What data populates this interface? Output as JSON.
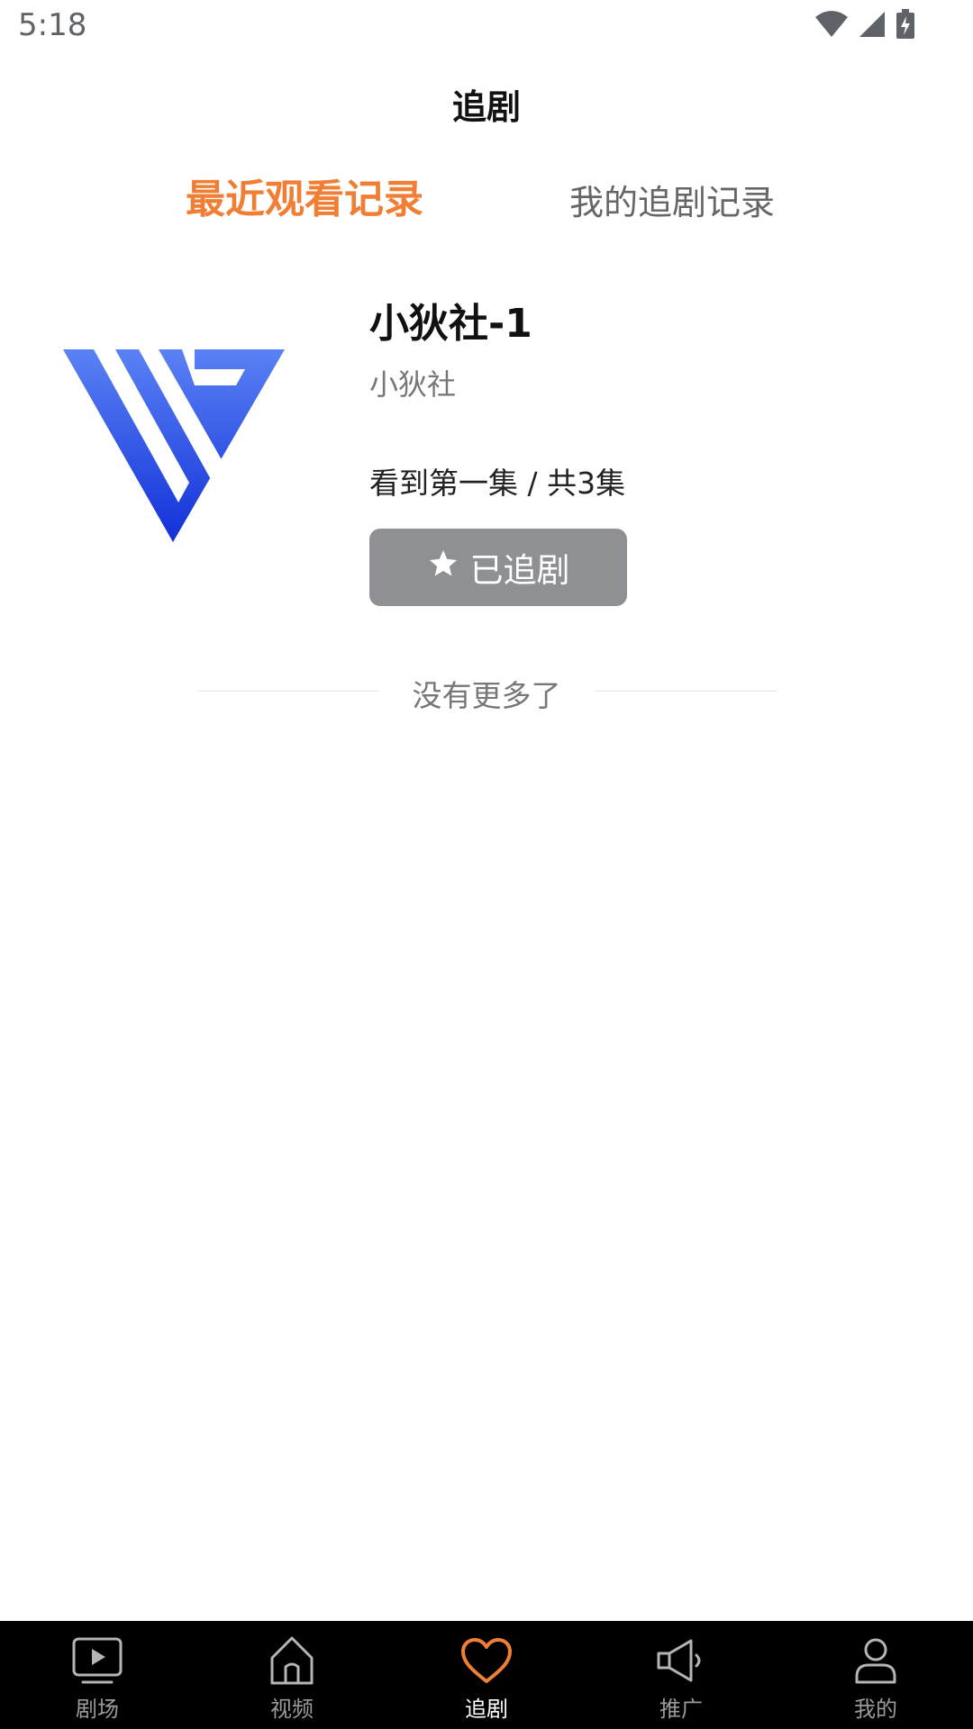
{
  "status_bar": {
    "time": "5:18",
    "icons": [
      "wifi-icon",
      "signal-icon",
      "battery-icon"
    ]
  },
  "header": {
    "title": "追剧"
  },
  "tabs": [
    {
      "label": "最近观看记录",
      "active": true
    },
    {
      "label": "我的追剧记录",
      "active": false
    }
  ],
  "item": {
    "title": "小狄社-1",
    "author": "小狄社",
    "progress": "看到第一集 / 共3集",
    "follow_button_label": "已追剧",
    "follow_button_icon": "star-icon"
  },
  "end_of_list": "没有更多了",
  "bottom_nav": {
    "items": [
      {
        "label": "剧场",
        "icon": "tv-play-icon",
        "active": false
      },
      {
        "label": "视频",
        "icon": "home-icon",
        "active": false
      },
      {
        "label": "追剧",
        "icon": "heart-icon",
        "active": true
      },
      {
        "label": "推广",
        "icon": "megaphone-icon",
        "active": false
      },
      {
        "label": "我的",
        "icon": "user-icon",
        "active": false
      }
    ]
  },
  "colors": {
    "accent": "#f07f35",
    "button_gray": "#8f9094",
    "nav_background": "#000000",
    "logo_blue": "#2a4fe0"
  }
}
